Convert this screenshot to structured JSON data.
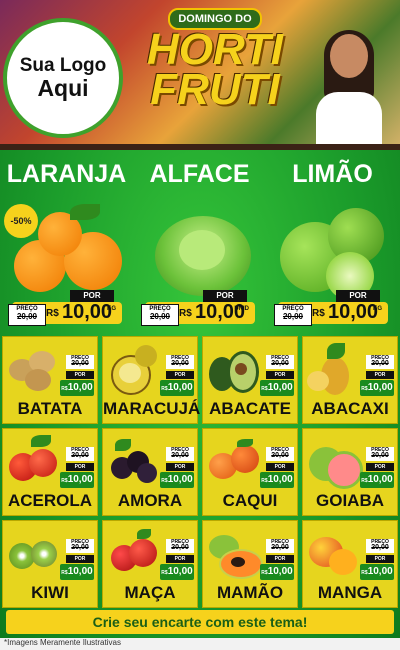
{
  "header": {
    "logo_line1": "Sua Logo",
    "logo_line2": "Aqui",
    "brand_top": "DOMINGO DO",
    "brand_line1": "HORTI",
    "brand_line2": "FRUTI"
  },
  "featured": [
    {
      "name": "LARANJA",
      "discount": "-50%",
      "por": "POR",
      "preco_label": "PREÇO",
      "old": "20,00",
      "currency": "R$",
      "price": "10,00",
      "unit": "KG"
    },
    {
      "name": "ALFACE",
      "por": "POR",
      "preco_label": "PREÇO",
      "old": "20,00",
      "currency": "R$",
      "price": "10,00",
      "unit": "UNID"
    },
    {
      "name": "LIMÃO",
      "por": "POR",
      "preco_label": "PREÇO",
      "old": "20,00",
      "currency": "R$",
      "price": "10,00",
      "unit": "KG"
    }
  ],
  "products": [
    {
      "name": "BATATA",
      "preco_label": "PREÇO",
      "old": "20,00",
      "por": "POR",
      "currency": "R$",
      "price": "10,00"
    },
    {
      "name": "MARACUJÁ",
      "preco_label": "PREÇO",
      "old": "20,00",
      "por": "POR",
      "currency": "R$",
      "price": "10,00"
    },
    {
      "name": "ABACATE",
      "preco_label": "PREÇO",
      "old": "20,00",
      "por": "POR",
      "currency": "R$",
      "price": "10,00"
    },
    {
      "name": "ABACAXI",
      "preco_label": "PREÇO",
      "old": "20,00",
      "por": "POR",
      "currency": "R$",
      "price": "10,00"
    },
    {
      "name": "ACEROLA",
      "preco_label": "PREÇO",
      "old": "20,00",
      "por": "POR",
      "currency": "R$",
      "price": "10,00"
    },
    {
      "name": "AMORA",
      "preco_label": "PREÇO",
      "old": "20,00",
      "por": "POR",
      "currency": "R$",
      "price": "10,00"
    },
    {
      "name": "CAQUI",
      "preco_label": "PREÇO",
      "old": "20,00",
      "por": "POR",
      "currency": "R$",
      "price": "10,00"
    },
    {
      "name": "GOIABA",
      "preco_label": "PREÇO",
      "old": "20,00",
      "por": "POR",
      "currency": "R$",
      "price": "10,00"
    },
    {
      "name": "KIWI",
      "preco_label": "PREÇO",
      "old": "20,00",
      "por": "POR",
      "currency": "R$",
      "price": "10,00"
    },
    {
      "name": "MAÇA",
      "preco_label": "PREÇO",
      "old": "20,00",
      "por": "POR",
      "currency": "R$",
      "price": "10,00"
    },
    {
      "name": "MAMÃO",
      "preco_label": "PREÇO",
      "old": "20,00",
      "por": "POR",
      "currency": "R$",
      "price": "10,00"
    },
    {
      "name": "MANGA",
      "preco_label": "PREÇO",
      "old": "20,00",
      "por": "POR",
      "currency": "R$",
      "price": "10,00"
    }
  ],
  "cta": "Crie seu encarte com este tema!",
  "footnote": "*Imagens Meramente Ilustrativas",
  "colors": {
    "accent_yellow": "#f6d21c",
    "green": "#1a9a2a",
    "price_green": "#1a8a1e"
  },
  "icons": [
    "orange-icon",
    "lettuce-icon",
    "lime-icon",
    "potato-icon",
    "passion-fruit-icon",
    "avocado-icon",
    "pineapple-icon",
    "acerola-icon",
    "blackberry-icon",
    "persimmon-icon",
    "guava-icon",
    "kiwi-icon",
    "apple-icon",
    "papaya-icon",
    "mango-icon"
  ]
}
